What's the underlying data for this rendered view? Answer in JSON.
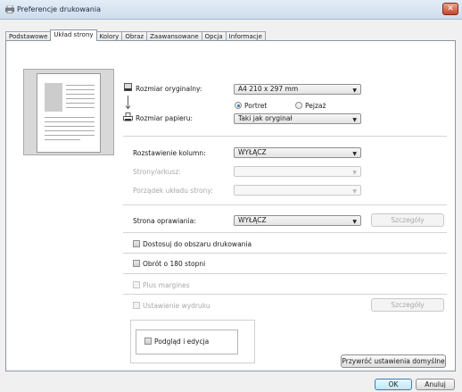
{
  "window": {
    "title": "Preferencje drukowania",
    "close_glyph": "✕"
  },
  "tabs": [
    {
      "label": "Podstawowe",
      "active": false
    },
    {
      "label": "Układ strony",
      "active": true
    },
    {
      "label": "Kolory",
      "active": false
    },
    {
      "label": "Obraz",
      "active": false
    },
    {
      "label": "Zaawansowane",
      "active": false
    },
    {
      "label": "Opcja",
      "active": false
    },
    {
      "label": "Informacje",
      "active": false
    }
  ],
  "fields": {
    "original_size": {
      "label": "Rozmiar oryginalny:",
      "value": "A4 210 x 297 mm"
    },
    "orientation": {
      "portrait": "Portret",
      "landscape": "Pejzaż",
      "selected": "portrait"
    },
    "paper_size": {
      "label": "Rozmiar papieru:",
      "value": "Taki jak oryginał"
    },
    "columns": {
      "label": "Rozstawienie kolumn:",
      "value": "WYŁĄCZ"
    },
    "pages_per_sheet": {
      "label": "Strony/arkusz:",
      "value": ""
    },
    "layout_order": {
      "label": "Porządek układu strony:",
      "value": ""
    },
    "binding": {
      "label": "Strona oprawiania:",
      "value": "WYŁĄCZ",
      "details": "Szczegóły"
    }
  },
  "checkboxes": {
    "fit_print_area": "Dostosuj do obszaru drukowania",
    "rotate_180": "Obrót o 180 stopni",
    "plus_margins": "Plus margines",
    "print_settings": "Ustawienie wydruku",
    "print_settings_details": "Szczegóły",
    "preview_edit": "Podgląd i edycja"
  },
  "buttons": {
    "restore_defaults": "Przywróć ustawienia domyślne",
    "ok": "OK",
    "cancel": "Anuluj"
  },
  "icons": {
    "combo_arrow": "▼",
    "titlebar": "printer-icon",
    "original": "original-document-icon",
    "paper": "paper-printer-icon",
    "arrow": "down-arrow-icon"
  },
  "colors": {
    "accent": "#2a74c8",
    "close": "#c6452a"
  }
}
